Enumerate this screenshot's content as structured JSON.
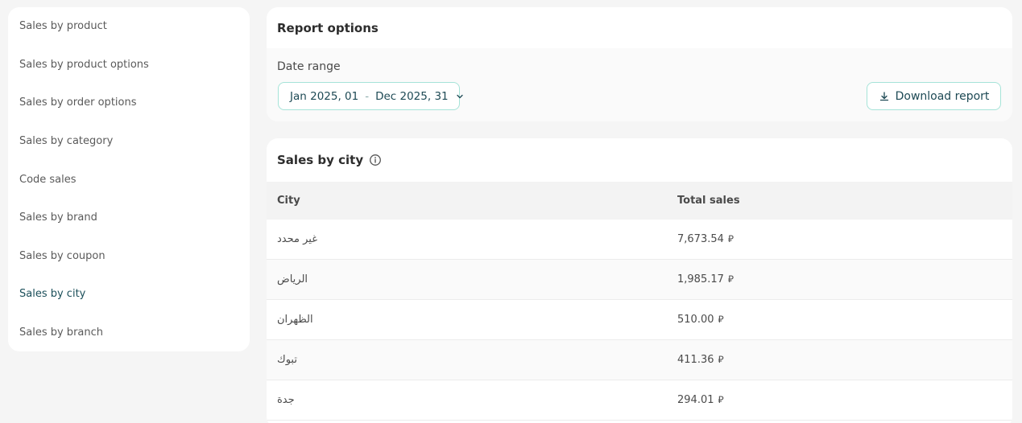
{
  "sidebar": {
    "items": [
      {
        "label": "Sales by product"
      },
      {
        "label": "Sales by product options"
      },
      {
        "label": "Sales by order options"
      },
      {
        "label": "Sales by category"
      },
      {
        "label": "Code sales"
      },
      {
        "label": "Sales by brand"
      },
      {
        "label": "Sales by coupon"
      },
      {
        "label": "Sales by city",
        "active": true
      },
      {
        "label": "Sales by branch"
      }
    ]
  },
  "report_options": {
    "title": "Report options",
    "date_range_label": "Date range",
    "date_from": "Jan 2025, 01",
    "date_separator": "-",
    "date_to": "Dec 2025, 31",
    "download_label": "Download report"
  },
  "sales_by_city": {
    "title": "Sales by city",
    "columns": {
      "city": "City",
      "total": "Total sales"
    },
    "currency_symbol": "⃁",
    "rows": [
      {
        "city": "غير محدد",
        "total": "7,673.54"
      },
      {
        "city": "الرياض",
        "total": "1,985.17"
      },
      {
        "city": "الظهران",
        "total": "510.00"
      },
      {
        "city": "تبوك",
        "total": "411.36"
      },
      {
        "city": "جدة",
        "total": "294.01"
      }
    ]
  },
  "colors": {
    "accent_border": "#a6e3d8",
    "active_text": "#1b4f5a",
    "background": "#f5f5f5"
  }
}
